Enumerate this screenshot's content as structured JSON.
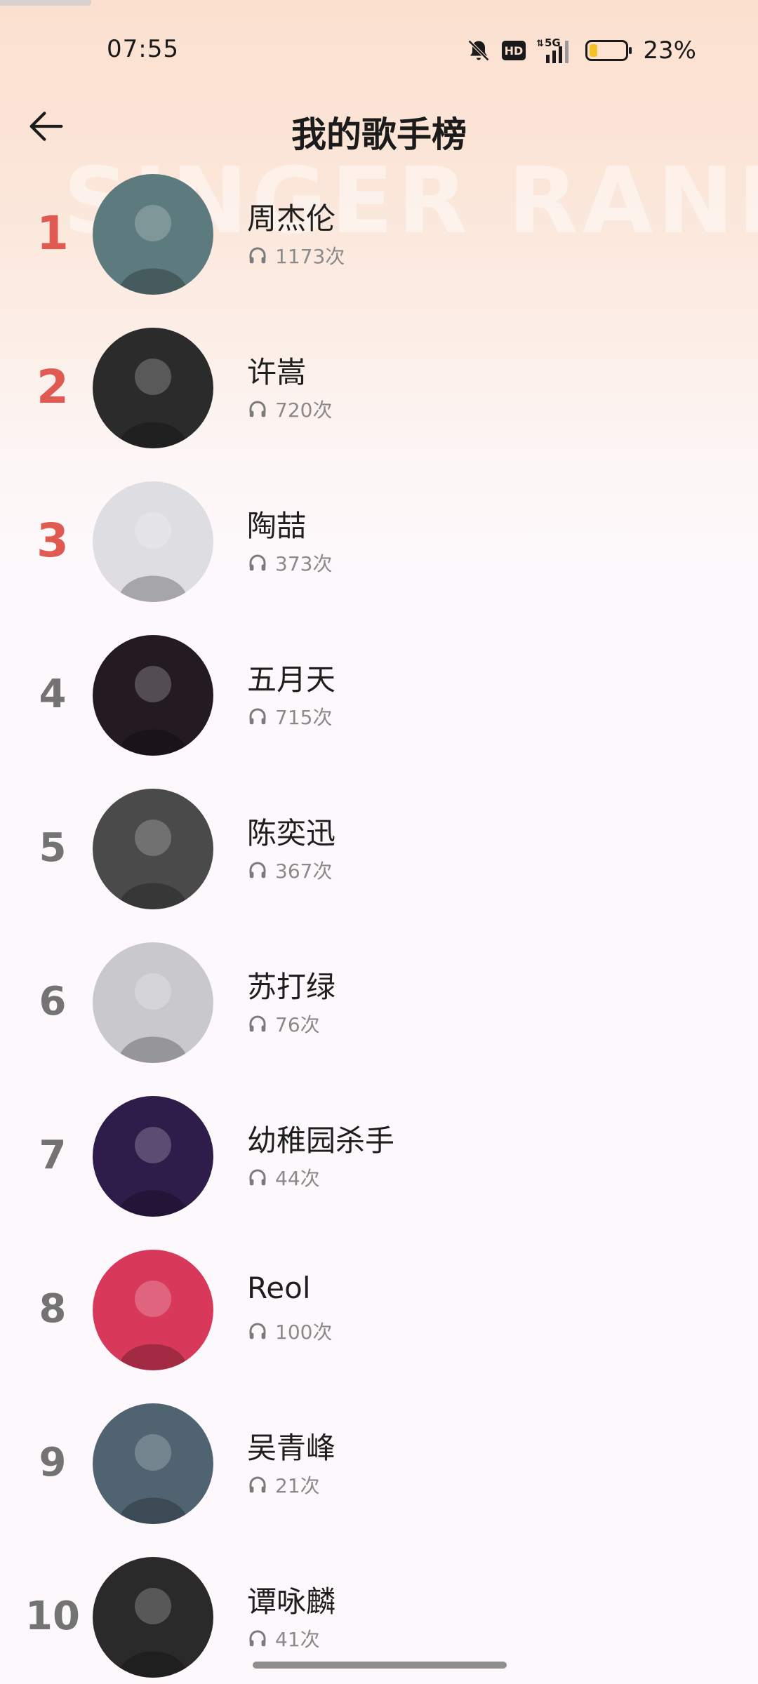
{
  "status_bar": {
    "time": "07:55",
    "network": "5G",
    "hd": "HD",
    "battery_percent": "23%",
    "battery_level": 0.23,
    "icons": [
      "bell-off-icon",
      "hd-icon",
      "5g-signal-icon",
      "battery-icon"
    ]
  },
  "header": {
    "title": "我的歌手榜",
    "back_icon": "arrow-left-icon"
  },
  "watermark": "SINGER RANK",
  "rank_items": [
    {
      "rank": "1",
      "name": "周杰伦",
      "plays": "1173次",
      "avatar_color": "#5d7a7e"
    },
    {
      "rank": "2",
      "name": "许嵩",
      "plays": "720次",
      "avatar_color": "#2b2b2b"
    },
    {
      "rank": "3",
      "name": "陶喆",
      "plays": "373次",
      "avatar_color": "#dedee2"
    },
    {
      "rank": "4",
      "name": "五月天",
      "plays": "715次",
      "avatar_color": "#231a22"
    },
    {
      "rank": "5",
      "name": "陈奕迅",
      "plays": "367次",
      "avatar_color": "#4a4a4a"
    },
    {
      "rank": "6",
      "name": "苏打绿",
      "plays": "76次",
      "avatar_color": "#c9c9cc"
    },
    {
      "rank": "7",
      "name": "幼稚园杀手",
      "plays": "44次",
      "avatar_color": "#2e1c4a"
    },
    {
      "rank": "8",
      "name": "Reol",
      "plays": "100次",
      "avatar_color": "#d8395a"
    },
    {
      "rank": "9",
      "name": "吴青峰",
      "plays": "21次",
      "avatar_color": "#4f6370"
    },
    {
      "rank": "10",
      "name": "谭咏麟",
      "plays": "41次",
      "avatar_color": "#2a2a2a"
    }
  ],
  "colors": {
    "top_rank": "#e05a52",
    "rank": "#737373",
    "count": "#8a8a8a"
  }
}
